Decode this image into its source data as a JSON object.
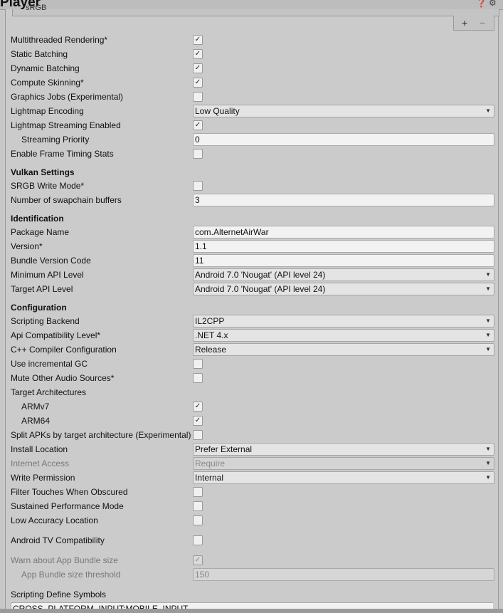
{
  "header": {
    "title": "Player",
    "help_icon": "help-icon",
    "settings_icon": "settings-icon"
  },
  "list": {
    "partial_item": "sRGB",
    "add": "+",
    "remove": "−"
  },
  "rows": [
    {
      "label": "Multithreaded Rendering*",
      "kind": "check",
      "checked": true
    },
    {
      "label": "Static Batching",
      "kind": "check",
      "checked": true
    },
    {
      "label": "Dynamic Batching",
      "kind": "check",
      "checked": true
    },
    {
      "label": "Compute Skinning*",
      "kind": "check",
      "checked": true
    },
    {
      "label": "Graphics Jobs (Experimental)",
      "kind": "check",
      "checked": false
    },
    {
      "label": "Lightmap Encoding",
      "kind": "dropdown",
      "value": "Low Quality"
    },
    {
      "label": "Lightmap Streaming Enabled",
      "kind": "check",
      "checked": true
    },
    {
      "label": "Streaming Priority",
      "kind": "text",
      "value": "0",
      "indent": true
    },
    {
      "label": "Enable Frame Timing Stats",
      "kind": "check",
      "checked": false
    },
    {
      "label": "Vulkan Settings",
      "kind": "header"
    },
    {
      "label": "SRGB Write Mode*",
      "kind": "check",
      "checked": false
    },
    {
      "label": "Number of swapchain buffers",
      "kind": "text",
      "value": "3"
    },
    {
      "label": "Identification",
      "kind": "header"
    },
    {
      "label": "Package Name",
      "kind": "text",
      "value": "com.AlternetAirWar"
    },
    {
      "label": "Version*",
      "kind": "text",
      "value": "1.1"
    },
    {
      "label": "Bundle Version Code",
      "kind": "text",
      "value": "11"
    },
    {
      "label": "Minimum API Level",
      "kind": "dropdown",
      "value": "Android 7.0 'Nougat' (API level 24)"
    },
    {
      "label": "Target API Level",
      "kind": "dropdown",
      "value": "Android 7.0 'Nougat' (API level 24)"
    },
    {
      "label": "Configuration",
      "kind": "header"
    },
    {
      "label": "Scripting Backend",
      "kind": "dropdown",
      "value": "IL2CPP"
    },
    {
      "label": "Api Compatibility Level*",
      "kind": "dropdown",
      "value": ".NET 4.x"
    },
    {
      "label": "C++ Compiler Configuration",
      "kind": "dropdown",
      "value": "Release"
    },
    {
      "label": "Use incremental GC",
      "kind": "check",
      "checked": false
    },
    {
      "label": "Mute Other Audio Sources*",
      "kind": "check",
      "checked": false
    },
    {
      "label": "Target Architectures",
      "kind": "label"
    },
    {
      "label": "ARMv7",
      "kind": "check",
      "checked": true,
      "indent": true
    },
    {
      "label": "ARM64",
      "kind": "check",
      "checked": true,
      "indent": true
    },
    {
      "label": "Split APKs by target architecture (Experimental)",
      "kind": "check",
      "checked": false
    },
    {
      "label": "Install Location",
      "kind": "dropdown",
      "value": "Prefer External"
    },
    {
      "label": "Internet Access",
      "kind": "dropdown",
      "value": "Require",
      "disabled": true
    },
    {
      "label": "Write Permission",
      "kind": "dropdown",
      "value": "Internal"
    },
    {
      "label": "Filter Touches When Obscured",
      "kind": "check",
      "checked": false
    },
    {
      "label": "Sustained Performance Mode",
      "kind": "check",
      "checked": false
    },
    {
      "label": "Low Accuracy Location",
      "kind": "check",
      "checked": false
    },
    {
      "label": "Android TV Compatibility",
      "kind": "check",
      "checked": false
    },
    {
      "label": "Warn about App Bundle size",
      "kind": "check",
      "checked": true,
      "disabled": true
    },
    {
      "label": "App Bundle size threshold",
      "kind": "text",
      "value": "150",
      "indent": true,
      "disabled": true
    },
    {
      "label": "Scripting Define Symbols",
      "kind": "label"
    }
  ],
  "define_symbols": "CROSS_PLATFORM_INPUT;MOBILE_INPUT"
}
